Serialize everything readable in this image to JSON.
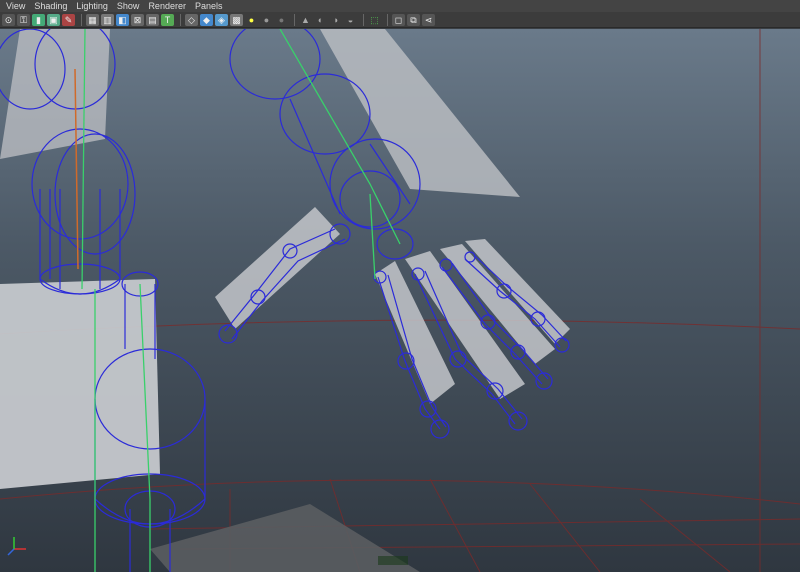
{
  "menubar": {
    "items": [
      "View",
      "Shading",
      "Lighting",
      "Show",
      "Renderer",
      "Panels"
    ]
  },
  "toolbar": {
    "icons": [
      "camera-select-icon",
      "camera-lock-icon",
      "bookmark-icon",
      "image-plane-icon",
      "grid-toggle-icon",
      "film-gate-icon",
      "resolution-gate-icon",
      "gate-mask-icon",
      "field-chart-icon",
      "safe-title-icon",
      "wireframe-icon",
      "smooth-shade-icon",
      "default-material-icon",
      "textured-icon",
      "use-lights-icon",
      "shadows-icon",
      "screen-space-ao-icon",
      "motion-blur-icon",
      "anti-alias-icon",
      "depth-of-field-icon",
      "isolate-select-icon",
      "xray-icon",
      "xray-joints-icon",
      "xray-components-icon"
    ]
  },
  "colors": {
    "wire": "#2b2bd8",
    "joint_green": "#39d06b",
    "plane_fill": "#b9bcc1",
    "grid": "#8a2a2a"
  }
}
